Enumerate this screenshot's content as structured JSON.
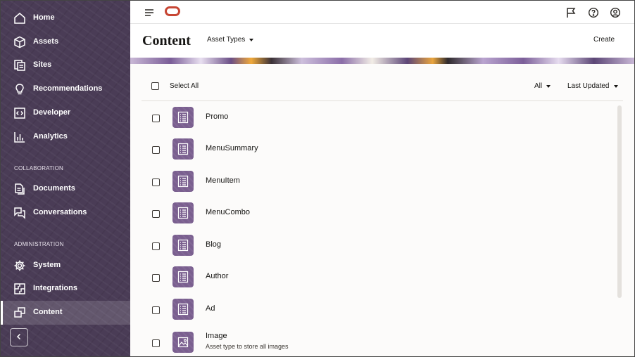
{
  "sidebar": {
    "items": [
      {
        "label": "Home",
        "icon": "home-icon"
      },
      {
        "label": "Assets",
        "icon": "cube-icon"
      },
      {
        "label": "Sites",
        "icon": "sites-icon"
      },
      {
        "label": "Recommendations",
        "icon": "lightbulb-icon"
      },
      {
        "label": "Developer",
        "icon": "code-icon"
      },
      {
        "label": "Analytics",
        "icon": "bar-chart-icon"
      }
    ],
    "collaboration_label": "COLLABORATION",
    "collaboration_items": [
      {
        "label": "Documents",
        "icon": "documents-icon"
      },
      {
        "label": "Conversations",
        "icon": "conversations-icon"
      }
    ],
    "administration_label": "ADMINISTRATION",
    "administration_items": [
      {
        "label": "System",
        "icon": "gear-icon"
      },
      {
        "label": "Integrations",
        "icon": "integrations-icon"
      },
      {
        "label": "Content",
        "icon": "content-icon",
        "active": true
      }
    ],
    "collapse_icon": "chevron-left-icon"
  },
  "topbar": {
    "menu_icon": "hamburger-icon",
    "logo": "oracle-logo",
    "icons": [
      "flag-icon",
      "help-icon",
      "user-icon"
    ]
  },
  "header": {
    "title": "Content",
    "asset_types_label": "Asset Types",
    "create_label": "Create"
  },
  "toolbar": {
    "select_all_label": "Select All",
    "filter_label": "All",
    "sort_label": "Last Updated"
  },
  "list": [
    {
      "name": "Promo",
      "description": "",
      "icon": "content-type-icon"
    },
    {
      "name": "MenuSummary",
      "description": "",
      "icon": "content-type-icon"
    },
    {
      "name": "MenuItem",
      "description": "",
      "icon": "content-type-icon"
    },
    {
      "name": "MenuCombo",
      "description": "",
      "icon": "content-type-icon"
    },
    {
      "name": "Blog",
      "description": "",
      "icon": "content-type-icon"
    },
    {
      "name": "Author",
      "description": "",
      "icon": "content-type-icon"
    },
    {
      "name": "Ad",
      "description": "",
      "icon": "content-type-icon"
    },
    {
      "name": "Image",
      "description": "Asset type to store all images",
      "icon": "image-type-icon"
    }
  ],
  "colors": {
    "sidebar_bg": "#4a3c56",
    "accent_logo": "#c74634",
    "thumb_bg": "#7a5f8f",
    "content_bg": "#fcfbfa"
  }
}
